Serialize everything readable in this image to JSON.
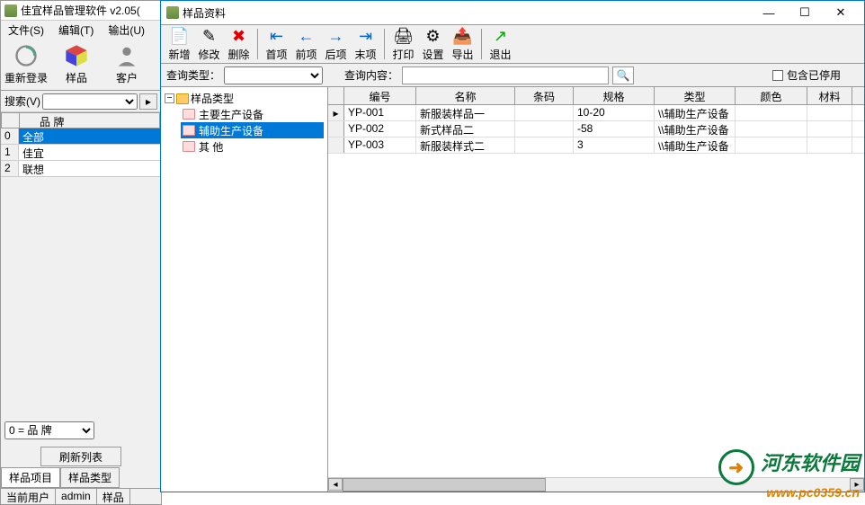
{
  "main": {
    "title": "佳宜样品管理软件 v2.05(",
    "menu": {
      "file": "文件(S)",
      "edit": "编辑(T)",
      "output": "输出(U)"
    },
    "toolbar": {
      "relogin": "重新登录",
      "sample": "样品",
      "customer": "客户"
    },
    "search_label": "搜索(V)",
    "brand_header": "品      牌",
    "brands": [
      {
        "idx": "0",
        "name": "全部",
        "selected": true
      },
      {
        "idx": "1",
        "name": "佳宜",
        "selected": false
      },
      {
        "idx": "2",
        "name": "联想",
        "selected": false
      }
    ],
    "filter_select": "0 = 品      牌",
    "refresh_btn": "刷新列表",
    "tabs": {
      "items": "样品项目",
      "types": "样品类型"
    },
    "status": {
      "user_label": "当前用户",
      "user_value": "admin",
      "sample": "样品"
    }
  },
  "sub": {
    "title": "样品资料",
    "toolbar": {
      "new": "新增",
      "edit": "修改",
      "delete": "删除",
      "first": "首项",
      "prev": "前项",
      "next": "后项",
      "last": "末项",
      "print": "打印",
      "settings": "设置",
      "export": "导出",
      "exit": "退出"
    },
    "query": {
      "type_label": "查询类型：",
      "content_label": "查询内容：",
      "include_stopped": "包含已停用"
    },
    "tree": {
      "root": "样品类型",
      "items": [
        {
          "label": "主要生产设备",
          "selected": false
        },
        {
          "label": "辅助生产设备",
          "selected": true
        },
        {
          "label": "其      他",
          "selected": false
        }
      ]
    },
    "columns": {
      "id": "编号",
      "name": "名称",
      "barcode": "条码",
      "spec": "规格",
      "type": "类型",
      "color": "颜色",
      "material": "材料"
    },
    "rows": [
      {
        "id": "YP-001",
        "name": "新服装样品一",
        "barcode": "",
        "spec": "10-20",
        "type": "\\\\辅助生产设备",
        "color": "",
        "material": ""
      },
      {
        "id": "YP-002",
        "name": "新式样品二",
        "barcode": "",
        "spec": "-58",
        "type": "\\\\辅助生产设备",
        "color": "",
        "material": ""
      },
      {
        "id": "YP-003",
        "name": "新服装样式二",
        "barcode": "",
        "spec": "3",
        "type": "\\\\辅助生产设备",
        "color": "",
        "material": ""
      }
    ]
  },
  "watermark": {
    "text": "河东软件园",
    "url": "www.pc0359.cn"
  }
}
